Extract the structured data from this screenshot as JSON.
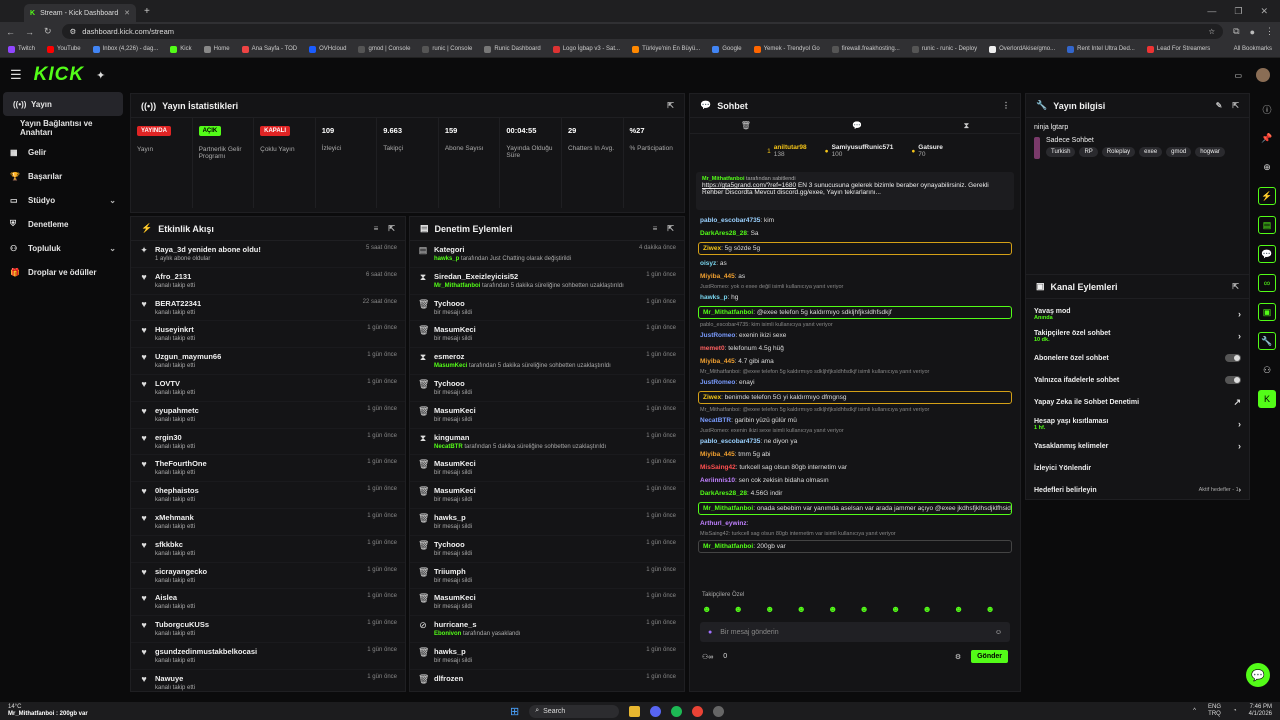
{
  "browser": {
    "tab_title": "Stream - Kick Dashboard",
    "url": "dashboard.kick.com/stream",
    "bookmarks": [
      "Twitch",
      "YouTube",
      "Inbox (4,226) - dag...",
      "Kick",
      "Home",
      "Ana Sayfa - TOD",
      "OVHcloud",
      "gmod | Console",
      "runic | Console",
      "Runic Dashboard",
      "Logo İgbap v3 - Sat...",
      "Türkiye'nin En Büyü...",
      "Google",
      "Yemek - Trendyol Go",
      "firewall.freakhosting...",
      "runic - runic - Deploy",
      "OverlordAkise/gmo...",
      "Rent Intel Ultra Ded...",
      "Lead For Streamers"
    ],
    "all_bookmarks": "All Bookmarks"
  },
  "sidebar": {
    "items": [
      {
        "label": "Yayın",
        "icon": "stream-icon"
      },
      {
        "label": "Yayın Bağlantısı ve Anahtarı",
        "icon": ""
      },
      {
        "label": "Gelir",
        "icon": "money-icon"
      },
      {
        "label": "Başarılar",
        "icon": "trophy-icon"
      },
      {
        "label": "Stüdyo",
        "icon": "studio-icon"
      },
      {
        "label": "Denetleme",
        "icon": "shield-icon"
      },
      {
        "label": "Topluluk",
        "icon": "community-icon"
      },
      {
        "label": "Droplar ve ödüller",
        "icon": "gift-icon"
      }
    ]
  },
  "stats": {
    "title": "Yayın İstatistikleri",
    "cells": [
      {
        "badge": "YAYINDA",
        "label": "Yayın"
      },
      {
        "badge": "AÇIK",
        "label": "Partnerlik Gelir Programı"
      },
      {
        "badge": "KAPALI",
        "label": "Çoklu Yayın"
      },
      {
        "value": "109",
        "label": "İzleyici"
      },
      {
        "value": "9.663",
        "label": "Takipçi"
      },
      {
        "value": "159",
        "label": "Abone Sayısı"
      },
      {
        "value": "00:04:55",
        "label": "Yayında Olduğu Süre"
      },
      {
        "value": "29",
        "label": "Chatters In Avg."
      },
      {
        "value": "%27",
        "label": "% Participation"
      }
    ]
  },
  "activity": {
    "title": "Etkinlik Akışı",
    "rows": [
      {
        "name": "Raya_3d yeniden abone oldu!",
        "sub": "1 aylık abone oldular",
        "time": "5 saat önce"
      },
      {
        "name": "Afro_2131",
        "sub": "kanalı takip etti",
        "time": "6 saat önce"
      },
      {
        "name": "BERAT22341",
        "sub": "kanalı takip etti",
        "time": "22 saat önce"
      },
      {
        "name": "Huseyinkrt",
        "sub": "kanalı takip etti",
        "time": "1 gün önce"
      },
      {
        "name": "Uzgun_maymun66",
        "sub": "kanalı takip etti",
        "time": "1 gün önce"
      },
      {
        "name": "LOVTV",
        "sub": "kanalı takip etti",
        "time": "1 gün önce"
      },
      {
        "name": "eyupahmetc",
        "sub": "kanalı takip etti",
        "time": "1 gün önce"
      },
      {
        "name": "ergin30",
        "sub": "kanalı takip etti",
        "time": "1 gün önce"
      },
      {
        "name": "TheFourthOne",
        "sub": "kanalı takip etti",
        "time": "1 gün önce"
      },
      {
        "name": "0hephaistos",
        "sub": "kanalı takip etti",
        "time": "1 gün önce"
      },
      {
        "name": "xMehmank",
        "sub": "kanalı takip etti",
        "time": "1 gün önce"
      },
      {
        "name": "sfkkbkc",
        "sub": "kanalı takip etti",
        "time": "1 gün önce"
      },
      {
        "name": "sicrayangecko",
        "sub": "kanalı takip etti",
        "time": "1 gün önce"
      },
      {
        "name": "Aislea",
        "sub": "kanalı takip etti",
        "time": "1 gün önce"
      },
      {
        "name": "TuborgcuKUSs",
        "sub": "kanalı takip etti",
        "time": "1 gün önce"
      },
      {
        "name": "gsundzedinmustakbelkocasi",
        "sub": "kanalı takip etti",
        "time": "1 gün önce"
      },
      {
        "name": "Nawuye",
        "sub": "kanalı takip etti",
        "time": "1 gün önce"
      }
    ]
  },
  "moderation": {
    "title": "Denetim Eylemleri",
    "rows": [
      {
        "icon": "category-icon",
        "name": "Kategori",
        "actor": "hawks_p",
        "rest": " tarafından Just Chatting olarak değiştirildi",
        "time": "4 dakika önce"
      },
      {
        "icon": "timeout-icon",
        "name": "Siredan_Exeizleyicisi52",
        "actor": "Mr_Mithatfanboi",
        "rest": " tarafından 5 dakika süreliğine sohbetten uzaklaştırıldı",
        "time": "1 gün önce"
      },
      {
        "icon": "trash-icon",
        "name": "Tychooo",
        "actor": "",
        "rest": "bir mesajı sildi",
        "time": "1 gün önce"
      },
      {
        "icon": "trash-icon",
        "name": "MasumKeci",
        "actor": "",
        "rest": "bir mesajı sildi",
        "time": "1 gün önce"
      },
      {
        "icon": "timeout-icon",
        "name": "esmeroz",
        "actor": "MasumKeci",
        "rest": " tarafından 5 dakika süreliğine sohbetten uzaklaştırıldı",
        "time": "1 gün önce"
      },
      {
        "icon": "trash-icon",
        "name": "Tychooo",
        "actor": "",
        "rest": "bir mesajı sildi",
        "time": "1 gün önce"
      },
      {
        "icon": "trash-icon",
        "name": "MasumKeci",
        "actor": "",
        "rest": "bir mesajı sildi",
        "time": "1 gün önce"
      },
      {
        "icon": "timeout-icon",
        "name": "kinguman",
        "actor": "NecatBTR",
        "rest": " tarafından 5 dakika süreliğine sohbetten uzaklaştırıldı",
        "time": "1 gün önce"
      },
      {
        "icon": "trash-icon",
        "name": "MasumKeci",
        "actor": "",
        "rest": "bir mesajı sildi",
        "time": "1 gün önce"
      },
      {
        "icon": "trash-icon",
        "name": "MasumKeci",
        "actor": "",
        "rest": "bir mesajı sildi",
        "time": "1 gün önce"
      },
      {
        "icon": "trash-icon",
        "name": "hawks_p",
        "actor": "",
        "rest": "bir mesajı sildi",
        "time": "1 gün önce"
      },
      {
        "icon": "trash-icon",
        "name": "Tychooo",
        "actor": "",
        "rest": "bir mesajı sildi",
        "time": "1 gün önce"
      },
      {
        "icon": "trash-icon",
        "name": "Triiumph",
        "actor": "",
        "rest": "bir mesajı sildi",
        "time": "1 gün önce"
      },
      {
        "icon": "trash-icon",
        "name": "MasumKeci",
        "actor": "",
        "rest": "bir mesajı sildi",
        "time": "1 gün önce"
      },
      {
        "icon": "ban-icon",
        "name": "hurricane_s",
        "actor": "Ebonivon",
        "rest": " tarafından yasaklandı",
        "time": "1 gün önce"
      },
      {
        "icon": "trash-icon",
        "name": "hawks_p",
        "actor": "",
        "rest": "bir mesajı sildi",
        "time": "1 gün önce"
      },
      {
        "icon": "trash-icon",
        "name": "dlfrozen",
        "actor": "",
        "rest": "",
        "time": "1 gün önce"
      }
    ]
  },
  "chat": {
    "title": "Sohbet",
    "leaders": [
      {
        "name": "aniltutar98",
        "count": "138"
      },
      {
        "name": "SamiyusufRunic571",
        "count": "100"
      },
      {
        "name": "Gatsure",
        "count": "70"
      }
    ],
    "pinned": {
      "by": "Mr_Mithatfanboi",
      "label": "tarafından sabitlendi",
      "link": "https://gta5grand.com/?ref=1680",
      "text": " EN 3 sunucusuna gelerek bizimle beraber oynayabilirsiniz. Gerekli Rehber Discordta Mevcut discord.gg/exee, Yayın tekrarlarını..."
    },
    "messages": [
      {
        "user": "pablo_escobar4735",
        "color": "#9ad1ff",
        "text": ": kim",
        "style": ""
      },
      {
        "user": "DarkAres28_28",
        "color": "#53fc18",
        "text": ": Sa",
        "style": ""
      },
      {
        "user": "Ziwex",
        "color": "#f5c518",
        "text": ": 5g sözde 5g",
        "style": "ybox"
      },
      {
        "user": "oisyz",
        "color": "#7ad7f0",
        "text": ": as",
        "style": ""
      },
      {
        "user": "Miyiba_445",
        "color": "#f0a030",
        "text": ": as",
        "style": ""
      },
      {
        "reply": "JustRomeo: yok o exee değil isimli kullanıcıya yanıt veriyor"
      },
      {
        "user": "hawks_p",
        "color": "#7ad7f0",
        "text": ": hg",
        "style": ""
      },
      {
        "user": "Mr_Mithatfanboi",
        "color": "#53fc18",
        "text": ": @exee telefon 5g kaldırmıyo sdkljhfjksldhfsdkjf",
        "style": "box"
      },
      {
        "reply": "pablo_escobar4735: kim isimli kullanıcıya yanıt veriyor"
      },
      {
        "user": "JustRomeo",
        "color": "#7a9cff",
        "text": ": exenin ikizi sexe",
        "style": ""
      },
      {
        "user": "memet0",
        "color": "#ff6060",
        "text": ": telefonum 4.5g hüğ",
        "style": ""
      },
      {
        "user": "Miyiba_445",
        "color": "#f0a030",
        "text": ": 4.7 gibi ama",
        "style": ""
      },
      {
        "reply": "Mr_Mithatfanboi: @exee telefon 5g kaldırmıyo sdkljhfjksldhfsdkjf isimli kullanıcıya yanıt veriyor"
      },
      {
        "user": "JustRomeo",
        "color": "#7a9cff",
        "text": ": enayi",
        "style": ""
      },
      {
        "user": "Ziwex",
        "color": "#f5c518",
        "text": ": benimde telefon 5G yi kaldırmıyo dfmgnsg",
        "style": "ybox"
      },
      {
        "reply": "Mr_Mithatfanboi: @exee telefon 5g kaldırmıyo sdkljhfjksldhfsdkjf isimli kullanıcıya yanıt veriyor"
      },
      {
        "user": "NecatBTR",
        "color": "#7a9cff",
        "text": ": garibin yüzü gülür mü",
        "style": ""
      },
      {
        "reply": "JustRomeo: exenin ikizi sexe isimli kullanıcıya yanıt veriyor"
      },
      {
        "user": "pablo_escobar4735",
        "color": "#9ad1ff",
        "text": ": ne diyon ya",
        "style": ""
      },
      {
        "user": "Miyiba_445",
        "color": "#f0a030",
        "text": ": tmm 5g abi",
        "style": ""
      },
      {
        "user": "MisSaing42",
        "color": "#ff5050",
        "text": ": turkcell sag olsun 80gb internetim var",
        "style": ""
      },
      {
        "user": "Aeriinnis10",
        "color": "#c080ff",
        "text": ": sen cok zekisin bidaha olmasın",
        "style": ""
      },
      {
        "user": "DarkAres28_28",
        "color": "#53fc18",
        "text": ": 4.56G indir",
        "style": ""
      },
      {
        "user": "Mr_Mithatfanboi",
        "color": "#53fc18",
        "text": ": onada sebebim var yanımda aselsan var arada jammer açıyo @exee jkdhsfjklhsdjklfhsidjkhfsd",
        "style": "box"
      },
      {
        "user": "Arthurl_eywinz",
        "color": "#c080ff",
        "text": ":",
        "style": ""
      },
      {
        "reply": "MisSaing42: turkcell sag olsun 80gb internetim var isimli kullanıcıya yanıt veriyor"
      },
      {
        "user": "Mr_Mithatfanboi",
        "color": "#53fc18",
        "text": ": 200gb var",
        "style": "box2"
      }
    ],
    "emote_label": "Takipçilere Özel",
    "input_placeholder": "Bir mesaj gönderin",
    "viewers": "0",
    "send_label": "Gönder"
  },
  "stream_info": {
    "title": "Yayın bilgisi",
    "stream_title": "ninja lgtarp",
    "chat_mode": "Sadece Sohbet",
    "tags": [
      "Turkish",
      "RP",
      "Roleplay",
      "exee",
      "gmod",
      "hogwar"
    ]
  },
  "channel_actions": {
    "title": "Kanal Eylemleri",
    "rows": [
      {
        "label": "Yavaş mod",
        "sub": "Anında",
        "control": "arrow"
      },
      {
        "label": "Takipçilere özel sohbet",
        "sub": "10 dk.",
        "control": "arrow"
      },
      {
        "label": "Abonelere özel sohbet",
        "sub": "",
        "control": "toggle"
      },
      {
        "label": "Yalnızca ifadelerle sohbet",
        "sub": "",
        "control": "toggle"
      },
      {
        "label": "Yapay Zeka ile Sohbet Denetimi",
        "sub": "",
        "control": "link"
      },
      {
        "label": "Hesap yaşı kısıtlaması",
        "sub": "1 hf.",
        "control": "arrow"
      },
      {
        "label": "Yasaklanmış kelimeler",
        "sub": "",
        "control": "arrow"
      },
      {
        "label": "İzleyici Yönlendir",
        "sub": "",
        "control": ""
      },
      {
        "label": "Hedefleri belirleyin",
        "sub": "",
        "control": "goal",
        "goal": "Aktif hedefler - 1"
      }
    ]
  },
  "taskbar": {
    "temp": "14°C",
    "ticker_user": "Mr_Mithatfanboi",
    "ticker_text": " : 200gb var",
    "search": "Search",
    "lang1": "ENG",
    "lang2": "TRQ",
    "time": "7:46 PM",
    "date": "4/1/2026"
  }
}
